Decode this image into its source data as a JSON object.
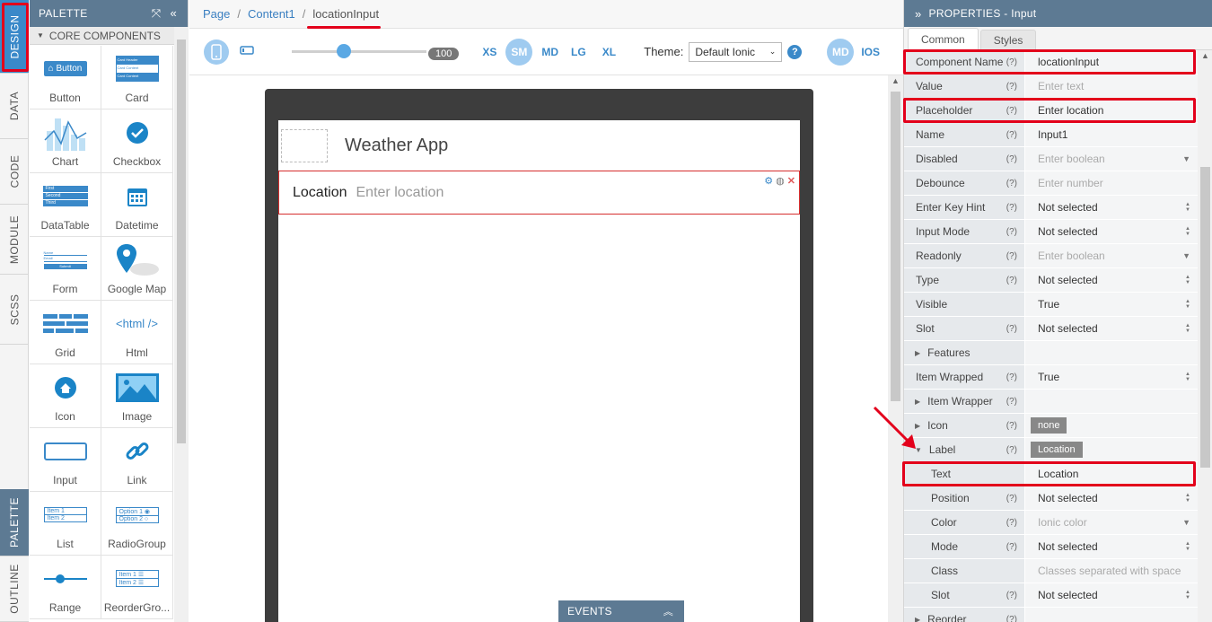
{
  "vtabs": [
    "DESIGN",
    "DATA",
    "CODE",
    "MODULE",
    "SCSS",
    "PALETTE",
    "OUTLINE"
  ],
  "palette": {
    "title": "PALETTE",
    "section": "CORE COMPONENTS",
    "items": [
      "Button",
      "Card",
      "Chart",
      "Checkbox",
      "DataTable",
      "Datetime",
      "Form",
      "Google Map",
      "Grid",
      "Html",
      "Icon",
      "Image",
      "Input",
      "Link",
      "List",
      "RadioGroup",
      "Range",
      "ReorderGro..."
    ],
    "glyphs": {
      "button": "Button",
      "html": "<html />",
      "list_item1": "Item 1",
      "list_item2": "Item 2",
      "radio_option1": "Option 1",
      "radio_option2": "Option 2",
      "reorder_item1": "Item 1",
      "reorder_item2": "Item 2",
      "table_row1": "First",
      "table_row2": "Second",
      "table_row3": "Third",
      "card_line1": "Card Header",
      "card_line2": "Card Content",
      "card_line3": "Card Content",
      "form_label1": "Name",
      "form_label2": "Email",
      "form_button": "Submit"
    }
  },
  "breadcrumb": [
    "Page",
    "Content1",
    "locationInput"
  ],
  "toolbar": {
    "zoom": "100",
    "breakpoints": [
      "XS",
      "SM",
      "MD",
      "LG",
      "XL"
    ],
    "selected_breakpoint": "SM",
    "theme_label": "Theme:",
    "theme_value": "Default Ionic",
    "help": "?",
    "mode_md": "MD",
    "mode_ios": "IOS"
  },
  "canvas": {
    "app_title": "Weather App",
    "input_label": "Location",
    "input_placeholder": "Enter location"
  },
  "events": {
    "label": "EVENTS"
  },
  "properties": {
    "title": "PROPERTIES - Input",
    "tabs": [
      "Common",
      "Styles"
    ],
    "rows": [
      {
        "key": "Component Name",
        "value": "locationInput",
        "q": "(?)"
      },
      {
        "key": "Value",
        "value": "Enter text",
        "q": "(?)"
      },
      {
        "key": "Placeholder",
        "value": "Enter location",
        "q": "(?)"
      },
      {
        "key": "Name",
        "value": "Input1",
        "q": "(?)"
      },
      {
        "key": "Disabled",
        "value": "Enter boolean",
        "q": "(?)"
      },
      {
        "key": "Debounce",
        "value": "Enter number",
        "q": "(?)"
      },
      {
        "key": "Enter Key Hint",
        "value": "Not selected",
        "q": "(?)"
      },
      {
        "key": "Input Mode",
        "value": "Not selected",
        "q": "(?)"
      },
      {
        "key": "Readonly",
        "value": "Enter boolean",
        "q": "(?)"
      },
      {
        "key": "Type",
        "value": "Not selected",
        "q": "(?)"
      },
      {
        "key": "Visible",
        "value": "True",
        "q": ""
      },
      {
        "key": "Slot",
        "value": "Not selected",
        "q": "(?)"
      },
      {
        "key": "Features",
        "value": "",
        "q": ""
      },
      {
        "key": "Item Wrapped",
        "value": "True",
        "q": "(?)"
      },
      {
        "key": "Item Wrapper",
        "value": "",
        "q": "(?)"
      },
      {
        "key": "Icon",
        "value": "none",
        "q": "(?)"
      },
      {
        "key": "Label",
        "value": "Location",
        "q": "(?)"
      },
      {
        "key": "Text",
        "value": "Location",
        "q": ""
      },
      {
        "key": "Position",
        "value": "Not selected",
        "q": "(?)"
      },
      {
        "key": "Color",
        "value": "Ionic color",
        "q": "(?)"
      },
      {
        "key": "Mode",
        "value": "Not selected",
        "q": "(?)"
      },
      {
        "key": "Class",
        "value": "Classes separated with space",
        "q": ""
      },
      {
        "key": "Slot",
        "value": "Not selected",
        "q": "(?)"
      },
      {
        "key": "Reorder",
        "value": "",
        "q": "(?)"
      }
    ]
  },
  "colors": {
    "accent": "#3a89c9",
    "header": "#5d7a93",
    "annotation": "#e3001b"
  }
}
